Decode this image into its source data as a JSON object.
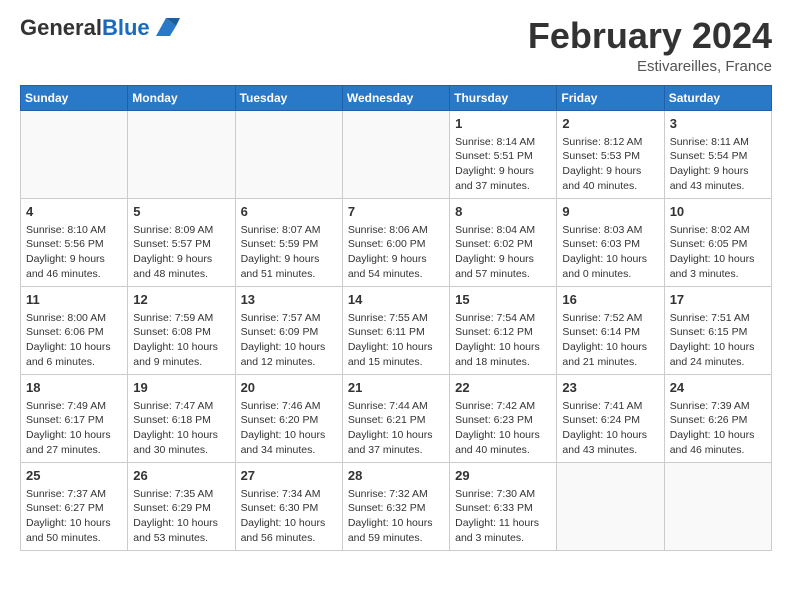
{
  "logo": {
    "general": "General",
    "blue": "Blue"
  },
  "title": {
    "month_year": "February 2024",
    "location": "Estivareilles, France"
  },
  "days_header": [
    "Sunday",
    "Monday",
    "Tuesday",
    "Wednesday",
    "Thursday",
    "Friday",
    "Saturday"
  ],
  "weeks": [
    [
      {
        "day": "",
        "info": ""
      },
      {
        "day": "",
        "info": ""
      },
      {
        "day": "",
        "info": ""
      },
      {
        "day": "",
        "info": ""
      },
      {
        "day": "1",
        "info": "Sunrise: 8:14 AM\nSunset: 5:51 PM\nDaylight: 9 hours and 37 minutes."
      },
      {
        "day": "2",
        "info": "Sunrise: 8:12 AM\nSunset: 5:53 PM\nDaylight: 9 hours and 40 minutes."
      },
      {
        "day": "3",
        "info": "Sunrise: 8:11 AM\nSunset: 5:54 PM\nDaylight: 9 hours and 43 minutes."
      }
    ],
    [
      {
        "day": "4",
        "info": "Sunrise: 8:10 AM\nSunset: 5:56 PM\nDaylight: 9 hours and 46 minutes."
      },
      {
        "day": "5",
        "info": "Sunrise: 8:09 AM\nSunset: 5:57 PM\nDaylight: 9 hours and 48 minutes."
      },
      {
        "day": "6",
        "info": "Sunrise: 8:07 AM\nSunset: 5:59 PM\nDaylight: 9 hours and 51 minutes."
      },
      {
        "day": "7",
        "info": "Sunrise: 8:06 AM\nSunset: 6:00 PM\nDaylight: 9 hours and 54 minutes."
      },
      {
        "day": "8",
        "info": "Sunrise: 8:04 AM\nSunset: 6:02 PM\nDaylight: 9 hours and 57 minutes."
      },
      {
        "day": "9",
        "info": "Sunrise: 8:03 AM\nSunset: 6:03 PM\nDaylight: 10 hours and 0 minutes."
      },
      {
        "day": "10",
        "info": "Sunrise: 8:02 AM\nSunset: 6:05 PM\nDaylight: 10 hours and 3 minutes."
      }
    ],
    [
      {
        "day": "11",
        "info": "Sunrise: 8:00 AM\nSunset: 6:06 PM\nDaylight: 10 hours and 6 minutes."
      },
      {
        "day": "12",
        "info": "Sunrise: 7:59 AM\nSunset: 6:08 PM\nDaylight: 10 hours and 9 minutes."
      },
      {
        "day": "13",
        "info": "Sunrise: 7:57 AM\nSunset: 6:09 PM\nDaylight: 10 hours and 12 minutes."
      },
      {
        "day": "14",
        "info": "Sunrise: 7:55 AM\nSunset: 6:11 PM\nDaylight: 10 hours and 15 minutes."
      },
      {
        "day": "15",
        "info": "Sunrise: 7:54 AM\nSunset: 6:12 PM\nDaylight: 10 hours and 18 minutes."
      },
      {
        "day": "16",
        "info": "Sunrise: 7:52 AM\nSunset: 6:14 PM\nDaylight: 10 hours and 21 minutes."
      },
      {
        "day": "17",
        "info": "Sunrise: 7:51 AM\nSunset: 6:15 PM\nDaylight: 10 hours and 24 minutes."
      }
    ],
    [
      {
        "day": "18",
        "info": "Sunrise: 7:49 AM\nSunset: 6:17 PM\nDaylight: 10 hours and 27 minutes."
      },
      {
        "day": "19",
        "info": "Sunrise: 7:47 AM\nSunset: 6:18 PM\nDaylight: 10 hours and 30 minutes."
      },
      {
        "day": "20",
        "info": "Sunrise: 7:46 AM\nSunset: 6:20 PM\nDaylight: 10 hours and 34 minutes."
      },
      {
        "day": "21",
        "info": "Sunrise: 7:44 AM\nSunset: 6:21 PM\nDaylight: 10 hours and 37 minutes."
      },
      {
        "day": "22",
        "info": "Sunrise: 7:42 AM\nSunset: 6:23 PM\nDaylight: 10 hours and 40 minutes."
      },
      {
        "day": "23",
        "info": "Sunrise: 7:41 AM\nSunset: 6:24 PM\nDaylight: 10 hours and 43 minutes."
      },
      {
        "day": "24",
        "info": "Sunrise: 7:39 AM\nSunset: 6:26 PM\nDaylight: 10 hours and 46 minutes."
      }
    ],
    [
      {
        "day": "25",
        "info": "Sunrise: 7:37 AM\nSunset: 6:27 PM\nDaylight: 10 hours and 50 minutes."
      },
      {
        "day": "26",
        "info": "Sunrise: 7:35 AM\nSunset: 6:29 PM\nDaylight: 10 hours and 53 minutes."
      },
      {
        "day": "27",
        "info": "Sunrise: 7:34 AM\nSunset: 6:30 PM\nDaylight: 10 hours and 56 minutes."
      },
      {
        "day": "28",
        "info": "Sunrise: 7:32 AM\nSunset: 6:32 PM\nDaylight: 10 hours and 59 minutes."
      },
      {
        "day": "29",
        "info": "Sunrise: 7:30 AM\nSunset: 6:33 PM\nDaylight: 11 hours and 3 minutes."
      },
      {
        "day": "",
        "info": ""
      },
      {
        "day": "",
        "info": ""
      }
    ]
  ]
}
